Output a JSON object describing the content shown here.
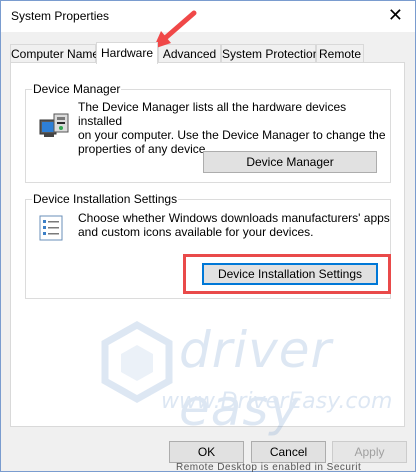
{
  "window": {
    "title": "System Properties",
    "close_glyph": "✕"
  },
  "tabs": [
    {
      "label": "Computer Name",
      "active": false
    },
    {
      "label": "Hardware",
      "active": true
    },
    {
      "label": "Advanced",
      "active": false
    },
    {
      "label": "System Protection",
      "active": false
    },
    {
      "label": "Remote",
      "active": false
    }
  ],
  "device_manager": {
    "group_label": "Device Manager",
    "description": "The Device Manager lists all the hardware devices installed on your computer. Use the Device Manager to change the properties of any device.",
    "description_lines": [
      "The Device Manager lists all the hardware devices installed",
      "on your computer. Use the Device Manager to change the",
      "properties of any device."
    ],
    "button_label": "Device Manager",
    "icon": "device-manager-icon"
  },
  "device_installation": {
    "group_label": "Device Installation Settings",
    "description_lines": [
      "Choose whether Windows downloads manufacturers' apps",
      "and custom icons available for your devices."
    ],
    "button_label": "Device Installation Settings",
    "icon": "settings-checklist-icon"
  },
  "footer": {
    "ok_label": "OK",
    "cancel_label": "Cancel",
    "apply_label": "Apply"
  },
  "annotation": {
    "highlight_color": "#e94a4a",
    "arrow_color": "#f04848"
  },
  "watermark": {
    "brand": "driver easy",
    "url": "www.DriverEasy.com"
  },
  "bottom_cutoff_text": "Remote Desktop is enabled in Securit"
}
